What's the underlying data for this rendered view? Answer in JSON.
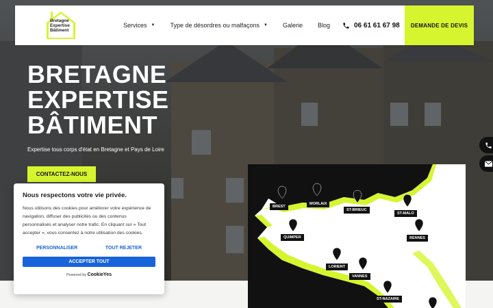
{
  "logo": {
    "lines": [
      "Bretagne",
      "Expertise",
      "Bâtiment"
    ]
  },
  "nav": {
    "services": "Services",
    "desordres": "Type de désordres ou malfaçons",
    "galerie": "Galerie",
    "blog": "Blog"
  },
  "phone": "06 61 61 67 98",
  "cta": "DEMANDE DE DEVIS",
  "hero": {
    "title_lines": [
      "BRETAGNE",
      "EXPERTISE",
      "BÂTIMENT"
    ],
    "subtitle": "Expertise tous corps d'état en Bretagne et Pays de Loire",
    "contact_button": "CONTACTEZ-NOUS"
  },
  "map": {
    "labels": [
      "BREST",
      "MORLAIX",
      "ST-BRIEUC",
      "ST-MALO",
      "QUIMPER",
      "RENNES",
      "LORIENT",
      "VANNES",
      "ST-NAZAIRE"
    ]
  },
  "cookie": {
    "title": "Nous respectons votre vie privée.",
    "body": "Nous utilisons des cookies pour améliorer votre expérience de navigation, diffuser des publicités ou des contenus personnalisés et analyser notre trafic. En cliquant sur « Tout accepter », vous consentez à notre utilisation des cookies.",
    "customize": "PERSONNALISER",
    "reject": "TOUT REJETER",
    "accept": "ACCEPTER TOUT",
    "powered_by": "Powered by",
    "brand": "CookieYes"
  },
  "colors": {
    "accent": "#d6f52f",
    "cookie_blue": "#1863dc",
    "dark": "#111111"
  },
  "icons": [
    "house-logo-icon",
    "phone-icon",
    "envelope-icon",
    "map-pin-icon",
    "caret-down-icon"
  ]
}
